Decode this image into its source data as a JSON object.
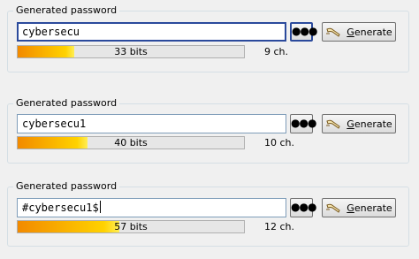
{
  "groups": [
    {
      "title": "Generated password",
      "password": "cybersecu",
      "strength_label": "33 bits",
      "strength_fraction": 0.25,
      "length_label": "9 ch.",
      "generate_label_u": "G",
      "generate_label_rest": "enerate",
      "dots_label": "●●●"
    },
    {
      "title": "Generated password",
      "password": "cybersecu1",
      "strength_label": "40 bits",
      "strength_fraction": 0.31,
      "length_label": "10 ch.",
      "generate_label_u": "G",
      "generate_label_rest": "enerate",
      "dots_label": "●●●"
    },
    {
      "title": "Generated password",
      "password": "#cybersecu1$",
      "strength_label": "57 bits",
      "strength_fraction": 0.45,
      "length_label": "12 ch.",
      "generate_label_u": "G",
      "generate_label_rest": "enerate",
      "dots_label": "●●●"
    }
  ],
  "icons": {
    "generate": "magic-wand-icon"
  }
}
